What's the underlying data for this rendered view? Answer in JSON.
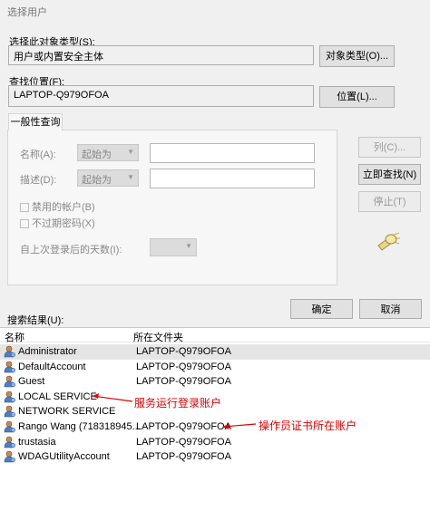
{
  "window": {
    "title": "选择用户"
  },
  "object_type": {
    "label": "选择此对象类型(S):",
    "value": "用户或内置安全主体",
    "button": "对象类型(O)..."
  },
  "location": {
    "label": "查找位置(F):",
    "value": "LAPTOP-Q979OFOA",
    "button": "位置(L)..."
  },
  "query": {
    "tab": "一般性查询",
    "name_label": "名称(A):",
    "name_combo": "起始为",
    "desc_label": "描述(D):",
    "desc_combo": "起始为",
    "disabled_accounts": "禁用的帐户(B)",
    "non_expiring": "不过期密码(X)",
    "days_label": "自上次登录后的天数(I):"
  },
  "side_buttons": {
    "columns": "列(C)...",
    "find_now": "立即查找(N)",
    "stop": "停止(T)"
  },
  "actions": {
    "ok": "确定",
    "cancel": "取消"
  },
  "results": {
    "label": "搜索结果(U):",
    "columns": [
      "名称",
      "所在文件夹"
    ],
    "rows": [
      {
        "name": "Administrator",
        "folder": "LAPTOP-Q979OFOA"
      },
      {
        "name": "DefaultAccount",
        "folder": "LAPTOP-Q979OFOA"
      },
      {
        "name": "Guest",
        "folder": "LAPTOP-Q979OFOA"
      },
      {
        "name": "LOCAL SERVICE",
        "folder": ""
      },
      {
        "name": "NETWORK SERVICE",
        "folder": ""
      },
      {
        "name": "Rango Wang (718318945...",
        "folder": "LAPTOP-Q979OFOA"
      },
      {
        "name": "trustasia",
        "folder": "LAPTOP-Q979OFOA"
      },
      {
        "name": "WDAGUtilityAccount",
        "folder": "LAPTOP-Q979OFOA"
      }
    ]
  },
  "annotations": {
    "service_account": "服务运行登录账户",
    "cert_account": "操作员证书所在账户",
    "color": "#e00000"
  }
}
